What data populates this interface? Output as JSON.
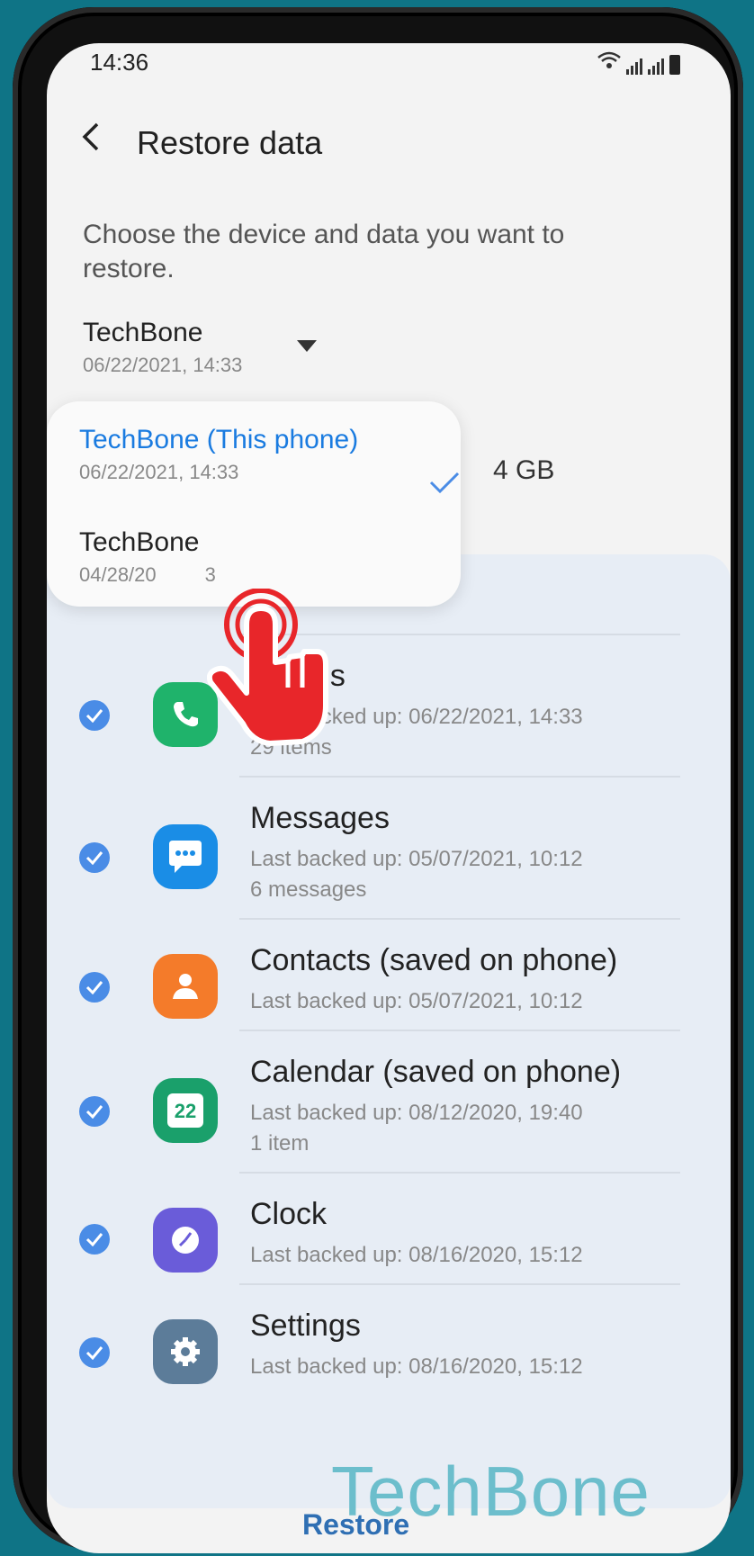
{
  "status": {
    "time": "14:36"
  },
  "header": {
    "title": "Restore data"
  },
  "description": "Choose the device and data you want to restore.",
  "selected_device": {
    "name": "TechBone",
    "date": "06/22/2021, 14:33"
  },
  "size_partial": "4 GB",
  "device_menu": {
    "options": [
      {
        "name": "TechBone  (This phone)",
        "date": "06/22/2021, 14:33",
        "selected": true
      },
      {
        "name": "TechBone",
        "date": "04/28/20",
        "date_tail": "3",
        "selected": false
      }
    ]
  },
  "items": [
    {
      "title": "Call logs",
      "title_visible": "all logs",
      "sub1": "Last backed up: 06/22/2021, 14:33",
      "sub2": "29 items",
      "icon": "phone-icon",
      "color": "#1fb36b"
    },
    {
      "title": "Messages",
      "sub1": "Last backed up: 05/07/2021, 10:12",
      "sub2": "6 messages",
      "icon": "chat-icon",
      "color": "#1a8de6"
    },
    {
      "title": "Contacts (saved on phone)",
      "sub1": "Last backed up: 05/07/2021, 10:12",
      "sub2": "",
      "icon": "person-icon",
      "color": "#f47b2a"
    },
    {
      "title": "Calendar (saved on phone)",
      "sub1": "Last backed up: 08/12/2020, 19:40",
      "sub2": "1 item",
      "icon": "calendar-icon",
      "color": "#1aa06b",
      "icon_text": "22"
    },
    {
      "title": "Clock",
      "sub1": "Last backed up: 08/16/2020, 15:12",
      "sub2": "",
      "icon": "clock-icon",
      "color": "#6a5cd9"
    },
    {
      "title": "Settings",
      "sub1": "Last backed up: 08/16/2020, 15:12",
      "sub2": "",
      "icon": "gear-icon",
      "color": "#5c7c99"
    }
  ],
  "footer": {
    "restore_label": "Restore"
  },
  "watermark": "TechBone",
  "colors": {
    "accent": "#1a73e8",
    "check": "#4a8ce6",
    "tap": "#e8262a"
  }
}
